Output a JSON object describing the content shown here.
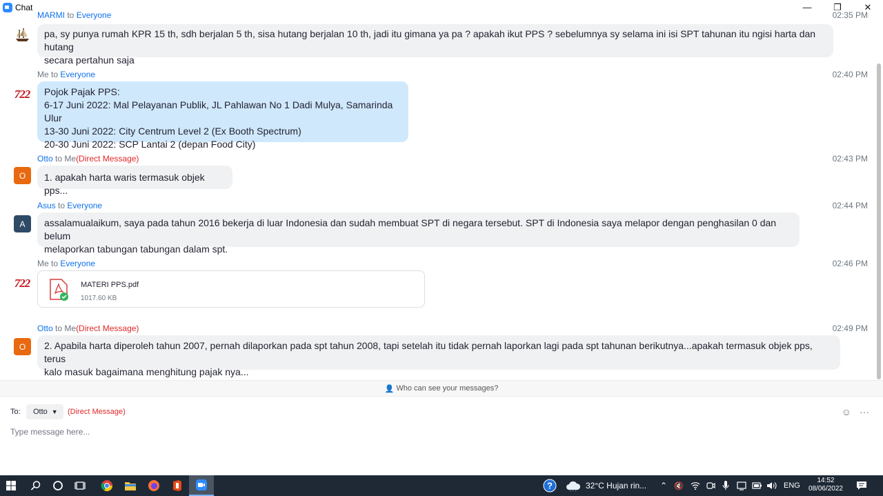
{
  "window": {
    "title": "Chat",
    "minimize": "—",
    "restore": "❐",
    "close": "✕"
  },
  "messages": [
    {
      "sender": "MARMI",
      "to_word": "to",
      "recipient": "Everyone",
      "time": "02:35 PM",
      "avatar_text": "",
      "lines": [
        "pa, sy punya rumah KPR 15 th, sdh berjalan 5 th, sisa hutang berjalan 10 th, jadi itu gimana ya pa ? apakah ikut PPS ? sebelumnya sy selama ini isi SPT tahunan itu ngisi harta dan hutang",
        "secara pertahun saja"
      ]
    },
    {
      "sender": "Me",
      "to_word": "to",
      "recipient": "Everyone",
      "time": "02:40 PM",
      "avatar_text": "722",
      "lines": [
        "Pojok Pajak PPS:",
        "6-17 Juni 2022: Mal Pelayanan Publik, JL Pahlawan No 1 Dadi Mulya, Samarinda Ulur",
        "13-30 Juni 2022: City Centrum Level 2 (Ex Booth Spectrum)",
        "20-30 Juni 2022: SCP Lantai 2 (depan Food City)"
      ]
    },
    {
      "sender": "Otto",
      "to_word": "to",
      "recipient": "Me",
      "dm": "(Direct Message)",
      "time": "02:43 PM",
      "avatar_text": "O",
      "lines": [
        "1. apakah harta waris termasuk objek pps..."
      ]
    },
    {
      "sender": "Asus",
      "to_word": "to",
      "recipient": "Everyone",
      "time": "02:44 PM",
      "avatar_text": "A",
      "lines": [
        "assalamualaikum, saya pada tahun 2016 bekerja di luar Indonesia dan sudah membuat SPT di negara tersebut. SPT di Indonesia saya melapor dengan penghasilan 0 dan belum",
        "melaporkan tabungan tabungan dalam spt."
      ]
    },
    {
      "sender": "Me",
      "to_word": "to",
      "recipient": "Everyone",
      "time": "02:46 PM",
      "avatar_text": "722",
      "file": {
        "name": "MATERI PPS.pdf",
        "size": "1017.60 KB"
      }
    },
    {
      "sender": "Otto",
      "to_word": "to",
      "recipient": "Me",
      "dm": "(Direct Message)",
      "time": "02:49 PM",
      "avatar_text": "O",
      "lines": [
        "2. Apabila harta diperoleh tahun 2007, pernah dilaporkan pada spt tahun 2008, tapi setelah itu tidak pernah laporkan lagi pada spt tahunan berikutnya...apakah termasuk objek pps, terus",
        "kalo masuk bagaimana menghitung pajak nya..."
      ]
    }
  ],
  "privacy_notice": "Who can see your messages?",
  "composer": {
    "to_label": "To:",
    "recipient": "Otto",
    "dm_label": "(Direct Message)",
    "placeholder": "Type message here...",
    "emoji_icon": "☺",
    "more_icon": "···"
  },
  "taskbar": {
    "weather": "32°C  Hujan rin...",
    "language": "ENG",
    "time": "14:52",
    "date": "08/06/2022"
  }
}
